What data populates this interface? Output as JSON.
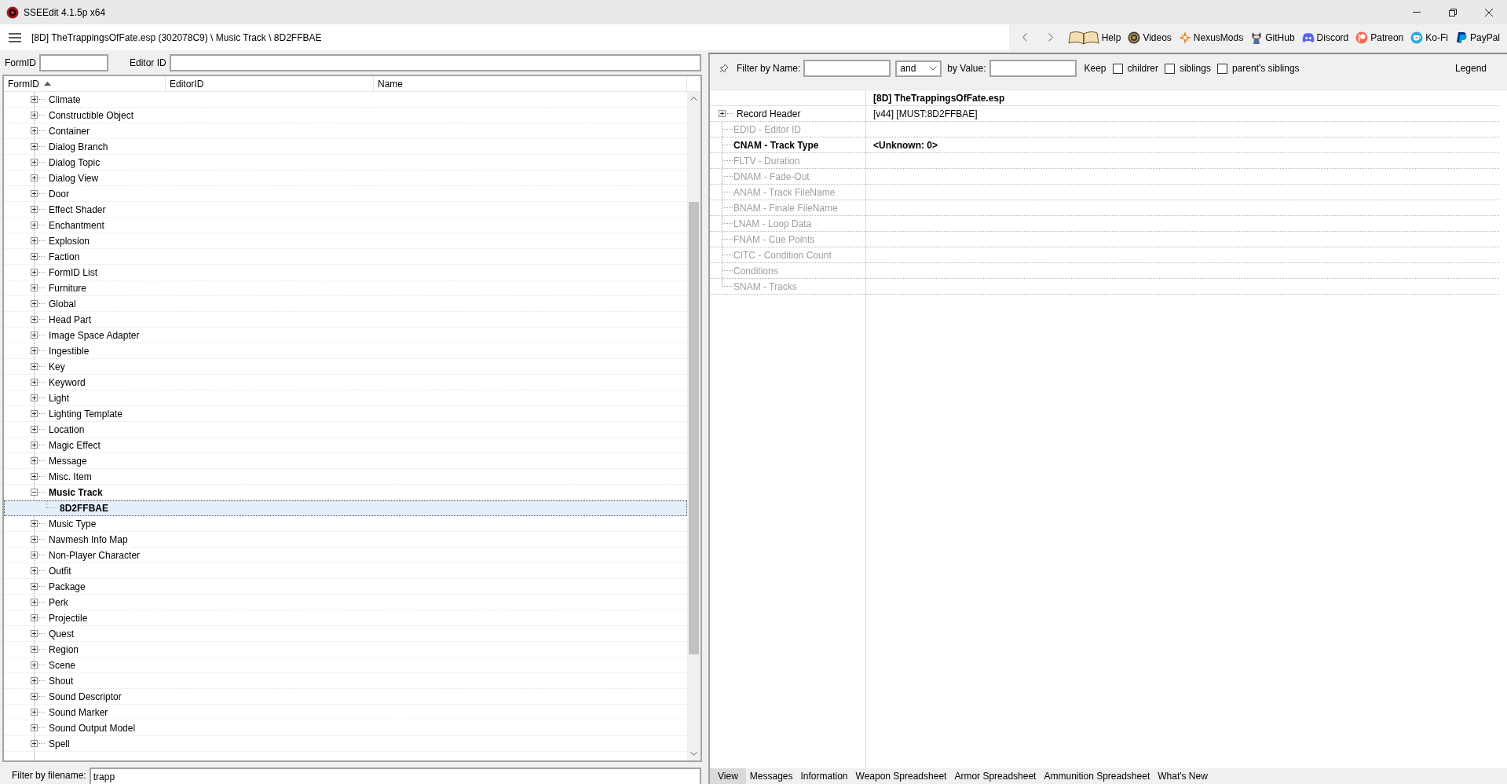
{
  "window": {
    "title": "SSEEdit 4.1.5p x64"
  },
  "toolbar": {
    "path": "[8D] TheTrappingsOfFate.esp (302078C9) \\ Music Track \\ 8D2FFBAE",
    "links": [
      {
        "label": "Help",
        "kind": "book"
      },
      {
        "label": "Videos",
        "kind": "coin"
      },
      {
        "label": "NexusMods",
        "kind": "compass"
      },
      {
        "label": "GitHub",
        "kind": "cat"
      },
      {
        "label": "Discord",
        "kind": "controller"
      },
      {
        "label": "Patreon",
        "kind": "ring"
      },
      {
        "label": "Ko-Fi",
        "kind": "cup"
      },
      {
        "label": "PayPal",
        "kind": "pmark"
      }
    ]
  },
  "left_panel": {
    "formid_label": "FormID",
    "editor_id_label": "Editor ID",
    "columns": [
      {
        "label": "FormID",
        "sorted": true
      },
      {
        "label": "EditorID",
        "sorted": false
      },
      {
        "label": "Name",
        "sorted": false
      }
    ],
    "tree": [
      {
        "label": "Climate",
        "expanded": false,
        "selected": false
      },
      {
        "label": "Constructible Object",
        "expanded": false,
        "selected": false
      },
      {
        "label": "Container",
        "expanded": false,
        "selected": false
      },
      {
        "label": "Dialog Branch",
        "expanded": false,
        "selected": false
      },
      {
        "label": "Dialog Topic",
        "expanded": false,
        "selected": false
      },
      {
        "label": "Dialog View",
        "expanded": false,
        "selected": false
      },
      {
        "label": "Door",
        "expanded": false,
        "selected": false
      },
      {
        "label": "Effect Shader",
        "expanded": false,
        "selected": false
      },
      {
        "label": "Enchantment",
        "expanded": false,
        "selected": false
      },
      {
        "label": "Explosion",
        "expanded": false,
        "selected": false
      },
      {
        "label": "Faction",
        "expanded": false,
        "selected": false
      },
      {
        "label": "FormID List",
        "expanded": false,
        "selected": false
      },
      {
        "label": "Furniture",
        "expanded": false,
        "selected": false
      },
      {
        "label": "Global",
        "expanded": false,
        "selected": false
      },
      {
        "label": "Head Part",
        "expanded": false,
        "selected": false
      },
      {
        "label": "Image Space Adapter",
        "expanded": false,
        "selected": false
      },
      {
        "label": "Ingestible",
        "expanded": false,
        "selected": false
      },
      {
        "label": "Key",
        "expanded": false,
        "selected": false
      },
      {
        "label": "Keyword",
        "expanded": false,
        "selected": false
      },
      {
        "label": "Light",
        "expanded": false,
        "selected": false
      },
      {
        "label": "Lighting Template",
        "expanded": false,
        "selected": false
      },
      {
        "label": "Location",
        "expanded": false,
        "selected": false
      },
      {
        "label": "Magic Effect",
        "expanded": false,
        "selected": false
      },
      {
        "label": "Message",
        "expanded": false,
        "selected": false
      },
      {
        "label": "Misc. Item",
        "expanded": false,
        "selected": false
      },
      {
        "label": "Music Track",
        "expanded": true,
        "selected": false,
        "children": [
          {
            "label": "8D2FFBAE",
            "selected": true
          }
        ]
      },
      {
        "label": "Music Type",
        "expanded": false,
        "selected": false
      },
      {
        "label": "Navmesh Info Map",
        "expanded": false,
        "selected": false
      },
      {
        "label": "Non-Player Character",
        "expanded": false,
        "selected": false
      },
      {
        "label": "Outfit",
        "expanded": false,
        "selected": false
      },
      {
        "label": "Package",
        "expanded": false,
        "selected": false
      },
      {
        "label": "Perk",
        "expanded": false,
        "selected": false
      },
      {
        "label": "Projectile",
        "expanded": false,
        "selected": false
      },
      {
        "label": "Quest",
        "expanded": false,
        "selected": false
      },
      {
        "label": "Region",
        "expanded": false,
        "selected": false
      },
      {
        "label": "Scene",
        "expanded": false,
        "selected": false
      },
      {
        "label": "Shout",
        "expanded": false,
        "selected": false
      },
      {
        "label": "Sound Descriptor",
        "expanded": false,
        "selected": false
      },
      {
        "label": "Sound Marker",
        "expanded": false,
        "selected": false
      },
      {
        "label": "Sound Output Model",
        "expanded": false,
        "selected": false
      },
      {
        "label": "Spell",
        "expanded": false,
        "selected": false
      }
    ],
    "filter_label": "Filter by filename:",
    "filter_value": "trapp"
  },
  "right_panel": {
    "filter_name_label": "Filter by Name:",
    "operator": "and",
    "filter_value_label": "by Value:",
    "keep_label": "Keep",
    "keep_options": [
      {
        "label": "childrer",
        "checked": false
      },
      {
        "label": "siblings",
        "checked": false
      },
      {
        "label": "parent's siblings",
        "checked": false
      }
    ],
    "legend": "Legend",
    "record": {
      "file_header": "[8D] TheTrappingsOfFate.esp",
      "fields": [
        {
          "label": "Record Header",
          "value": "[v44] [MUST:8D2FFBAE]",
          "kind": "group",
          "present": true,
          "emphasized": false
        },
        {
          "label": "EDID - Editor ID",
          "kind": "field",
          "present": false,
          "emphasized": false
        },
        {
          "label": "CNAM - Track Type",
          "value": "<Unknown: 0>",
          "kind": "field",
          "present": true,
          "emphasized": true
        },
        {
          "label": "FLTV - Duration",
          "kind": "field",
          "present": false,
          "emphasized": false
        },
        {
          "label": "DNAM - Fade-Out",
          "kind": "field",
          "present": false,
          "emphasized": false
        },
        {
          "label": "ANAM - Track FileName",
          "kind": "field",
          "present": false,
          "emphasized": false
        },
        {
          "label": "BNAM - Finale FileName",
          "kind": "field",
          "present": false,
          "emphasized": false
        },
        {
          "label": "LNAM - Loop Data",
          "kind": "field",
          "present": false,
          "emphasized": false
        },
        {
          "label": "FNAM - Cue Points",
          "kind": "field",
          "present": false,
          "emphasized": false
        },
        {
          "label": "CITC - Condition Count",
          "kind": "field",
          "present": false,
          "emphasized": false
        },
        {
          "label": "Conditions",
          "kind": "field",
          "present": false,
          "emphasized": false
        },
        {
          "label": "SNAM - Tracks",
          "kind": "field",
          "present": false,
          "emphasized": false
        }
      ]
    }
  },
  "bottom_tabs": [
    {
      "label": "View",
      "selected": true
    },
    {
      "label": "Messages",
      "selected": false
    },
    {
      "label": "Information",
      "selected": false
    },
    {
      "label": "Weapon Spreadsheet",
      "selected": false
    },
    {
      "label": "Armor Spreadsheet",
      "selected": false
    },
    {
      "label": "Ammunition Spreadsheet",
      "selected": false
    },
    {
      "label": "What's New",
      "selected": false
    }
  ]
}
